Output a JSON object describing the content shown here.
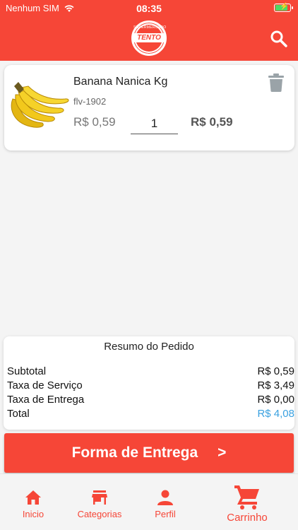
{
  "status_bar": {
    "carrier": "Nenhum SIM",
    "time": "08:35"
  },
  "header": {
    "logo_text": "TENTO",
    "logo_subtext": "SUPERMERCADO"
  },
  "cart_item": {
    "name": "Banana Nanica Kg",
    "sku": "flv-1902",
    "unit_price": "R$ 0,59",
    "quantity": "1",
    "total": "R$ 0,59"
  },
  "summary": {
    "title": "Resumo do Pedido",
    "rows": [
      {
        "label": "Subtotal",
        "value": "R$ 0,59"
      },
      {
        "label": "Taxa de Serviço",
        "value": "R$ 3,49"
      },
      {
        "label": "Taxa de Entrega",
        "value": "R$ 0,00"
      },
      {
        "label": "Total",
        "value": "R$ 4,08"
      }
    ]
  },
  "delivery_button": {
    "label": "Forma de Entrega",
    "arrow": ">"
  },
  "bottom_nav": {
    "items": [
      {
        "label": "Inicio",
        "icon": "home-icon"
      },
      {
        "label": "Categorias",
        "icon": "store-icon"
      },
      {
        "label": "Perfil",
        "icon": "person-icon"
      },
      {
        "label": "Carrinho",
        "icon": "cart-icon"
      }
    ]
  },
  "colors": {
    "primary": "#f64637",
    "accent_total": "#3aa1e0"
  }
}
